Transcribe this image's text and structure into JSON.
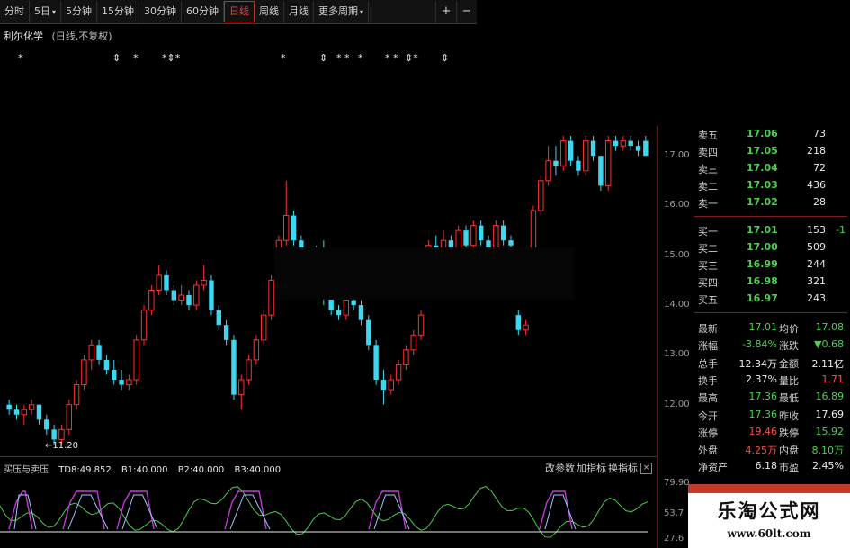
{
  "toolbar": {
    "buttons": [
      "分时",
      "5日",
      "5分钟",
      "15分钟",
      "30分钟",
      "60分钟",
      "日线",
      "周线",
      "月线",
      "更多周期"
    ],
    "active_index": 6,
    "dropdown_indices": [
      1,
      9
    ],
    "icons": [
      "+",
      "−"
    ]
  },
  "stock": {
    "name": "利尔化学",
    "mode": "(日线,不复权)"
  },
  "signals": [
    "*",
    "⇕",
    "*",
    "*⇕*",
    "*",
    "⇕",
    "* *",
    "*",
    "* *",
    "⇕*",
    "⇕"
  ],
  "chart_data": {
    "type": "candlestick",
    "title": "",
    "y_ticks": [
      "17.00",
      "16.00",
      "15.00",
      "14.00",
      "13.00",
      "12.00"
    ],
    "ylim": [
      11.0,
      17.6
    ],
    "low_marker": "11.20",
    "candles_ohlc": [
      [
        12.0,
        12.1,
        11.8,
        11.9
      ],
      [
        11.9,
        12.0,
        11.7,
        11.8
      ],
      [
        11.8,
        12.0,
        11.6,
        11.9
      ],
      [
        11.9,
        12.1,
        11.8,
        12.0
      ],
      [
        12.0,
        12.0,
        11.6,
        11.7
      ],
      [
        11.7,
        11.8,
        11.4,
        11.5
      ],
      [
        11.5,
        11.6,
        11.2,
        11.3
      ],
      [
        11.3,
        11.6,
        11.2,
        11.5
      ],
      [
        11.5,
        12.1,
        11.4,
        12.0
      ],
      [
        12.0,
        12.5,
        11.9,
        12.4
      ],
      [
        12.4,
        13.0,
        12.3,
        12.9
      ],
      [
        12.9,
        13.3,
        12.7,
        13.2
      ],
      [
        13.2,
        13.3,
        12.8,
        12.9
      ],
      [
        12.9,
        13.0,
        12.6,
        12.7
      ],
      [
        12.7,
        12.9,
        12.4,
        12.5
      ],
      [
        12.5,
        12.7,
        12.3,
        12.4
      ],
      [
        12.4,
        12.6,
        12.3,
        12.5
      ],
      [
        12.5,
        13.4,
        12.4,
        13.3
      ],
      [
        13.3,
        14.0,
        13.2,
        13.9
      ],
      [
        13.9,
        14.4,
        13.8,
        14.3
      ],
      [
        14.3,
        14.8,
        14.2,
        14.6
      ],
      [
        14.6,
        14.7,
        14.2,
        14.3
      ],
      [
        14.3,
        14.4,
        14.0,
        14.1
      ],
      [
        14.1,
        14.4,
        14.0,
        14.2
      ],
      [
        14.2,
        14.3,
        13.9,
        14.0
      ],
      [
        14.0,
        14.5,
        13.9,
        14.4
      ],
      [
        14.4,
        14.8,
        14.3,
        14.5
      ],
      [
        14.5,
        14.6,
        13.8,
        13.9
      ],
      [
        13.9,
        14.0,
        13.5,
        13.6
      ],
      [
        13.6,
        13.7,
        13.2,
        13.3
      ],
      [
        13.3,
        13.4,
        12.1,
        12.2
      ],
      [
        12.2,
        12.6,
        11.9,
        12.5
      ],
      [
        12.5,
        13.0,
        12.4,
        12.9
      ],
      [
        12.9,
        13.4,
        12.8,
        13.3
      ],
      [
        13.3,
        13.9,
        13.2,
        13.8
      ],
      [
        13.8,
        14.6,
        13.7,
        14.5
      ],
      [
        14.5,
        15.4,
        14.4,
        15.3
      ],
      [
        15.3,
        16.5,
        15.2,
        15.8
      ],
      [
        15.8,
        15.9,
        15.2,
        15.3
      ],
      [
        15.3,
        15.4,
        14.7,
        14.8
      ],
      [
        14.8,
        15.0,
        14.5,
        14.6
      ],
      [
        14.6,
        15.2,
        14.5,
        15.1
      ],
      [
        15.1,
        15.3,
        14.0,
        14.2
      ],
      [
        14.2,
        14.3,
        13.8,
        13.9
      ],
      [
        13.9,
        14.0,
        13.7,
        13.8
      ],
      [
        13.8,
        14.2,
        13.7,
        14.1
      ],
      [
        14.1,
        14.3,
        13.9,
        14.0
      ],
      [
        14.0,
        14.1,
        13.6,
        13.7
      ],
      [
        13.7,
        13.8,
        13.1,
        13.2
      ],
      [
        13.2,
        13.3,
        12.4,
        12.5
      ],
      [
        12.5,
        12.7,
        12.0,
        12.3
      ],
      [
        12.3,
        12.6,
        12.2,
        12.5
      ],
      [
        12.5,
        12.9,
        12.4,
        12.8
      ],
      [
        12.8,
        13.2,
        12.7,
        13.1
      ],
      [
        13.1,
        13.5,
        13.0,
        13.4
      ],
      [
        13.4,
        13.9,
        13.3,
        13.8
      ],
      [
        15.0,
        15.3,
        14.9,
        15.2
      ],
      [
        15.2,
        15.4,
        14.9,
        15.0
      ],
      [
        15.0,
        15.5,
        14.9,
        15.3
      ],
      [
        15.3,
        15.4,
        15.0,
        15.1
      ],
      [
        15.1,
        15.6,
        15.0,
        15.5
      ],
      [
        15.5,
        15.6,
        15.1,
        15.2
      ],
      [
        15.2,
        15.7,
        15.1,
        15.6
      ],
      [
        15.6,
        15.7,
        15.2,
        15.3
      ],
      [
        15.3,
        15.4,
        15.0,
        15.1
      ],
      [
        15.1,
        15.7,
        15.0,
        15.6
      ],
      [
        15.6,
        15.7,
        15.2,
        15.3
      ],
      [
        15.3,
        15.4,
        15.0,
        15.2
      ],
      [
        13.8,
        13.9,
        13.4,
        13.5
      ],
      [
        13.5,
        13.7,
        13.4,
        13.6
      ],
      [
        14.5,
        16.0,
        14.4,
        15.9
      ],
      [
        15.9,
        16.6,
        15.8,
        16.5
      ],
      [
        16.5,
        17.2,
        16.4,
        16.9
      ],
      [
        16.9,
        17.2,
        16.6,
        16.8
      ],
      [
        16.8,
        17.4,
        16.7,
        17.3
      ],
      [
        17.3,
        17.4,
        16.8,
        16.9
      ],
      [
        16.9,
        17.0,
        16.6,
        16.7
      ],
      [
        16.7,
        17.4,
        16.6,
        17.3
      ],
      [
        17.3,
        17.4,
        16.9,
        17.0
      ],
      [
        17.0,
        17.0,
        16.3,
        16.4
      ],
      [
        16.4,
        17.4,
        16.3,
        17.3
      ],
      [
        17.3,
        17.4,
        17.1,
        17.2
      ],
      [
        17.2,
        17.4,
        17.1,
        17.3
      ],
      [
        17.3,
        17.4,
        17.1,
        17.2
      ],
      [
        17.2,
        17.3,
        17.0,
        17.1
      ],
      [
        17.3,
        17.4,
        17.0,
        17.0
      ]
    ]
  },
  "order_book": {
    "asks": [
      {
        "label": "卖五",
        "price": "17.06",
        "vol": "73"
      },
      {
        "label": "卖四",
        "price": "17.05",
        "vol": "218"
      },
      {
        "label": "卖三",
        "price": "17.04",
        "vol": "72"
      },
      {
        "label": "卖二",
        "price": "17.03",
        "vol": "436"
      },
      {
        "label": "卖一",
        "price": "17.02",
        "vol": "28"
      }
    ],
    "bids": [
      {
        "label": "买一",
        "price": "17.01",
        "vol": "153",
        "delta": "-1"
      },
      {
        "label": "买二",
        "price": "17.00",
        "vol": "509",
        "delta": ""
      },
      {
        "label": "买三",
        "price": "16.99",
        "vol": "244",
        "delta": ""
      },
      {
        "label": "买四",
        "price": "16.98",
        "vol": "321",
        "delta": ""
      },
      {
        "label": "买五",
        "price": "16.97",
        "vol": "243",
        "delta": ""
      }
    ]
  },
  "stats": [
    {
      "l1": "最新",
      "v1": "17.01",
      "c1": "green",
      "l2": "均价",
      "v2": "17.08",
      "c2": "green"
    },
    {
      "l1": "涨幅",
      "v1": "-3.84%",
      "c1": "green",
      "l2": "涨跌",
      "v2": "▼0.68",
      "c2": "green"
    },
    {
      "l1": "总手",
      "v1": "12.34万",
      "c1": "white",
      "l2": "金额",
      "v2": "2.11亿",
      "c2": "white"
    },
    {
      "l1": "换手",
      "v1": "2.37%",
      "c1": "white",
      "l2": "量比",
      "v2": "1.71",
      "c2": "red"
    },
    {
      "l1": "最高",
      "v1": "17.36",
      "c1": "green",
      "l2": "最低",
      "v2": "16.89",
      "c2": "green"
    },
    {
      "l1": "今开",
      "v1": "17.36",
      "c1": "green",
      "l2": "昨收",
      "v2": "17.69",
      "c2": "white"
    },
    {
      "l1": "涨停",
      "v1": "19.46",
      "c1": "red",
      "l2": "跌停",
      "v2": "15.92",
      "c2": "green"
    },
    {
      "l1": "外盘",
      "v1": "4.25万",
      "c1": "red",
      "l2": "内盘",
      "v2": "8.10万",
      "c2": "green"
    },
    {
      "l1": "净资产",
      "v1": "6.18",
      "c1": "white",
      "l2": "市盈",
      "v2": "2.45%",
      "c2": "white"
    }
  ],
  "indicator": {
    "name": "买压与卖压",
    "td": "TD8:49.852",
    "b1": "B1:40.000",
    "b2": "B2:40.000",
    "b3": "B3:40.000",
    "buttons": [
      "改参数",
      "加指标",
      "换指标"
    ],
    "close": "×",
    "ticks": [
      "79.90",
      "53.7",
      "27.6"
    ]
  },
  "watermark": {
    "title": "乐淘公式网",
    "url": "www.60lt.com"
  },
  "colors": {
    "up": "#ff3030",
    "down": "#3fd6f0",
    "ask_green": "#4cd04c",
    "accent_red": "#c03030"
  }
}
